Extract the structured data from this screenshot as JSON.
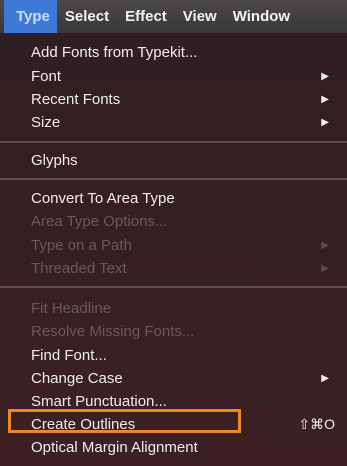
{
  "menubar": {
    "items": [
      "Type",
      "Select",
      "Effect",
      "View",
      "Window"
    ]
  },
  "menu": {
    "add_fonts": "Add Fonts from Typekit...",
    "font": "Font",
    "recent_fonts": "Recent Fonts",
    "size": "Size",
    "glyphs": "Glyphs",
    "convert_area": "Convert To Area Type",
    "area_options": "Area Type Options...",
    "type_on_path": "Type on a Path",
    "threaded_text": "Threaded Text",
    "fit_headline": "Fit Headline",
    "resolve_fonts": "Resolve Missing Fonts...",
    "find_font": "Find Font...",
    "change_case": "Change Case",
    "smart_punct": "Smart Punctuation...",
    "create_outlines": "Create Outlines",
    "create_outlines_shortcut": "⇧⌘O",
    "optical_margin": "Optical Margin Alignment"
  },
  "colors": {
    "highlight_border": "#ef8a23",
    "active_menu": "#3f79d8"
  }
}
